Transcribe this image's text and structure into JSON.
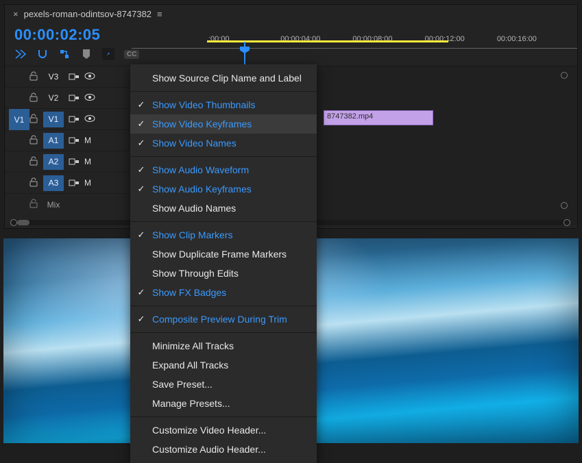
{
  "header": {
    "title": "pexels-roman-odintsov-8747382"
  },
  "timecode": "00:00:02:05",
  "ruler": {
    "labels": [
      ":00:00",
      "00:00:04:00",
      "00:00:08:00",
      "00:00:12:00",
      "00:00:16:00"
    ]
  },
  "tracks": {
    "target": "V1",
    "rows": [
      {
        "name": "V3",
        "type": "video",
        "selected": false
      },
      {
        "name": "V2",
        "type": "video",
        "selected": false
      },
      {
        "name": "V1",
        "type": "video",
        "selected": true
      },
      {
        "name": "A1",
        "type": "audio",
        "selected": true
      },
      {
        "name": "A2",
        "type": "audio",
        "selected": true
      },
      {
        "name": "A3",
        "type": "audio",
        "selected": true
      },
      {
        "name": "Mix",
        "type": "mix",
        "selected": false
      }
    ]
  },
  "clip_label": "8747382.mp4",
  "menu": {
    "items": [
      {
        "label": "Show Source Clip Name and Label",
        "checked": false
      },
      {
        "sep": true
      },
      {
        "label": "Show Video Thumbnails",
        "checked": true
      },
      {
        "label": "Show Video Keyframes",
        "checked": true,
        "hover": true
      },
      {
        "label": "Show Video Names",
        "checked": true
      },
      {
        "sep": true
      },
      {
        "label": "Show Audio Waveform",
        "checked": true
      },
      {
        "label": "Show Audio Keyframes",
        "checked": true
      },
      {
        "label": "Show Audio Names",
        "checked": false
      },
      {
        "sep": true
      },
      {
        "label": "Show Clip Markers",
        "checked": true
      },
      {
        "label": "Show Duplicate Frame Markers",
        "checked": false
      },
      {
        "label": "Show Through Edits",
        "checked": false
      },
      {
        "label": "Show FX Badges",
        "checked": true
      },
      {
        "sep": true
      },
      {
        "label": "Composite Preview During Trim",
        "checked": true
      },
      {
        "sep": true
      },
      {
        "label": "Minimize All Tracks",
        "checked": false
      },
      {
        "label": "Expand All Tracks",
        "checked": false
      },
      {
        "label": "Save Preset...",
        "checked": false
      },
      {
        "label": "Manage Presets...",
        "checked": false
      },
      {
        "sep": true
      },
      {
        "label": "Customize Video Header...",
        "checked": false
      },
      {
        "label": "Customize Audio Header...",
        "checked": false
      }
    ]
  }
}
